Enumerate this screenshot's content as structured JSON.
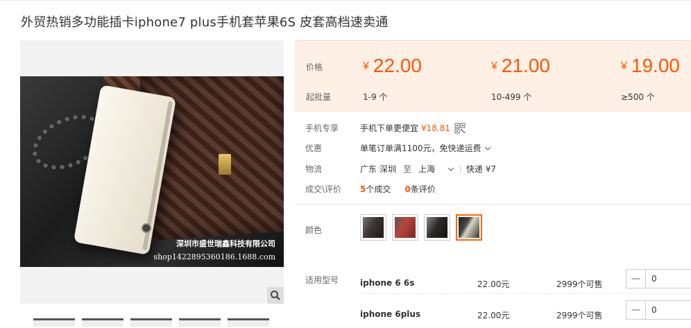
{
  "product": {
    "title": "外贸热销多功能插卡iphone7 plus手机套苹果6S 皮套高档速卖通"
  },
  "gallery": {
    "watermark_line1": "深圳市盛世瑞鑫科技有限公司",
    "watermark_line2": "shop1422895360186.1688.com",
    "zoom_icon": "magnifier-icon"
  },
  "pricing": {
    "price_label": "价格",
    "qty_label": "起批量",
    "currency": "¥",
    "tiers": [
      {
        "price": "22.00",
        "range": "1-9 个"
      },
      {
        "price": "21.00",
        "range": "10-499 个"
      },
      {
        "price": "19.00",
        "range": "≥500 个"
      }
    ],
    "accent_color": "#ff5500"
  },
  "mobile": {
    "label": "手机专享",
    "text": "手机下单更便宜",
    "price": "¥18.81",
    "icon": "qrcode-icon"
  },
  "promo": {
    "label": "优惠",
    "text": "单笔订单满1100元，免快递运费"
  },
  "logistics": {
    "label": "物流",
    "from_province": "广东",
    "from_city": "深圳",
    "to_word": "至",
    "to_city": "上海",
    "express": "快递 ¥7"
  },
  "reviews": {
    "label": "成交\\评价",
    "deals_count": "5",
    "deals_text": "个成交",
    "review_count": "0",
    "review_text": "条评价"
  },
  "color": {
    "label": "颜色",
    "options": [
      {
        "name": "black",
        "swatch": "#3b3533"
      },
      {
        "name": "red",
        "swatch": "#b5463a"
      },
      {
        "name": "dark",
        "swatch": "#2e2a29"
      },
      {
        "name": "white",
        "swatch": "#d9d3c2",
        "selected": true
      }
    ]
  },
  "models": {
    "label": "适用型号",
    "rows": [
      {
        "name": "iphone 6 6s",
        "price": "22.00元",
        "stock": "2999个可售",
        "qty": "0"
      },
      {
        "name": "iphone 6plus",
        "price": "22.00元",
        "stock": "2999个可售",
        "qty": "0"
      }
    ]
  }
}
